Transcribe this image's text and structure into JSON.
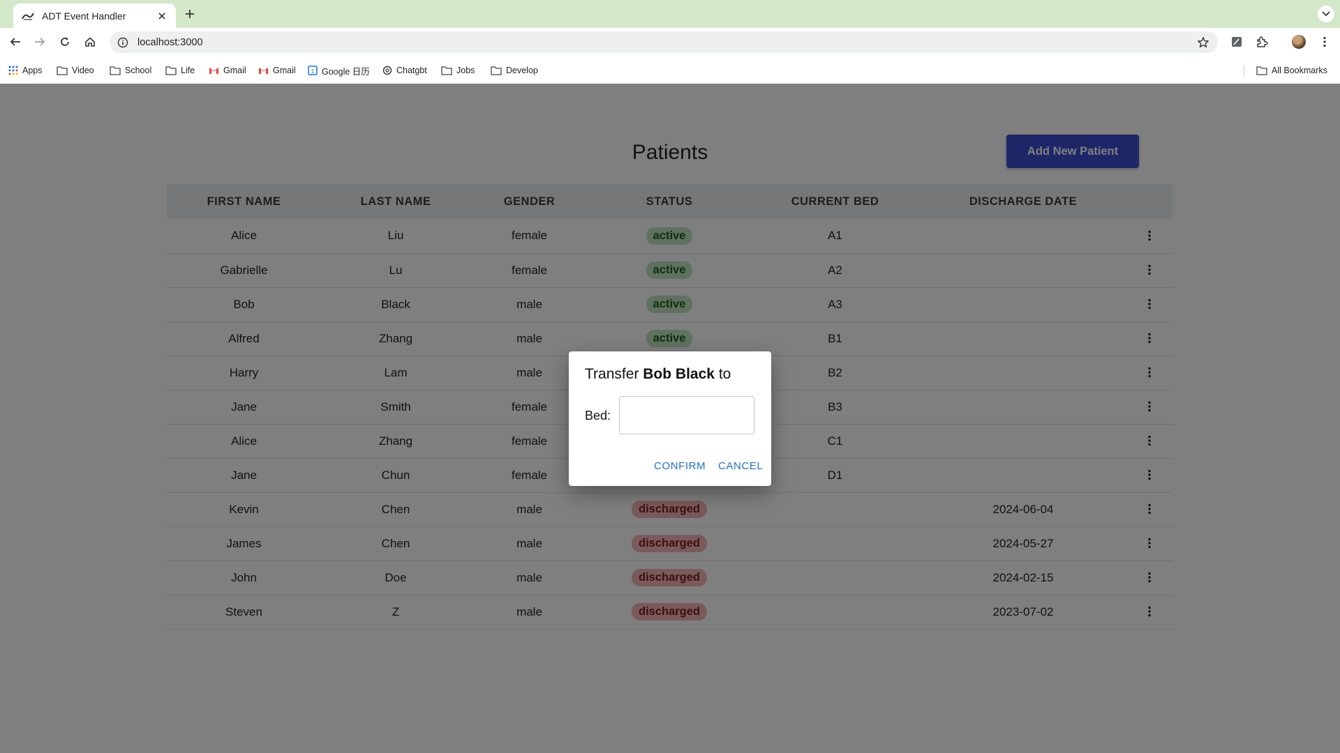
{
  "browser": {
    "tab_title": "ADT Event Handler",
    "url": "localhost:3000",
    "bookmarks": [
      {
        "label": "Apps",
        "icon": "apps-grid-icon"
      },
      {
        "label": "Video",
        "icon": "folder-icon"
      },
      {
        "label": "School",
        "icon": "folder-icon"
      },
      {
        "label": "Life",
        "icon": "folder-icon"
      },
      {
        "label": "Gmail",
        "icon": "gmail-icon"
      },
      {
        "label": "Gmail",
        "icon": "gmail-icon"
      },
      {
        "label": "Google 日历",
        "icon": "google-calendar-icon"
      },
      {
        "label": "Chatgbt",
        "icon": "chatgpt-icon"
      },
      {
        "label": "Jobs",
        "icon": "folder-icon"
      },
      {
        "label": "Develop",
        "icon": "folder-icon"
      }
    ],
    "all_bookmarks_label": "All Bookmarks"
  },
  "page": {
    "title": "Patients",
    "add_button": "Add New Patient",
    "columns": [
      "FIRST NAME",
      "LAST NAME",
      "GENDER",
      "STATUS",
      "CURRENT BED",
      "DISCHARGE DATE"
    ],
    "rows": [
      {
        "first": "Alice",
        "last": "Liu",
        "gender": "female",
        "status": "active",
        "bed": "A1",
        "discharge": ""
      },
      {
        "first": "Gabrielle",
        "last": "Lu",
        "gender": "female",
        "status": "active",
        "bed": "A2",
        "discharge": ""
      },
      {
        "first": "Bob",
        "last": "Black",
        "gender": "male",
        "status": "active",
        "bed": "A3",
        "discharge": ""
      },
      {
        "first": "Alfred",
        "last": "Zhang",
        "gender": "male",
        "status": "active",
        "bed": "B1",
        "discharge": ""
      },
      {
        "first": "Harry",
        "last": "Lam",
        "gender": "male",
        "status": "",
        "bed": "B2",
        "discharge": ""
      },
      {
        "first": "Jane",
        "last": "Smith",
        "gender": "female",
        "status": "",
        "bed": "B3",
        "discharge": ""
      },
      {
        "first": "Alice",
        "last": "Zhang",
        "gender": "female",
        "status": "",
        "bed": "C1",
        "discharge": ""
      },
      {
        "first": "Jane",
        "last": "Chun",
        "gender": "female",
        "status": "",
        "bed": "D1",
        "discharge": ""
      },
      {
        "first": "Kevin",
        "last": "Chen",
        "gender": "male",
        "status": "discharged",
        "bed": "",
        "discharge": "2024-06-04"
      },
      {
        "first": "James",
        "last": "Chen",
        "gender": "male",
        "status": "discharged",
        "bed": "",
        "discharge": "2024-05-27"
      },
      {
        "first": "John",
        "last": "Doe",
        "gender": "male",
        "status": "discharged",
        "bed": "",
        "discharge": "2024-02-15"
      },
      {
        "first": "Steven",
        "last": "Z",
        "gender": "male",
        "status": "discharged",
        "bed": "",
        "discharge": "2023-07-02"
      }
    ]
  },
  "dialog": {
    "title_prefix": "Transfer",
    "patient_name": "Bob Black",
    "title_suffix": "to",
    "bed_label": "Bed:",
    "bed_value": "",
    "confirm": "CONFIRM",
    "cancel": "CANCEL"
  },
  "colors": {
    "tabstrip": "#d3e8c8",
    "add_button": "#3a4fd0",
    "active_badge": "#bfe3bf",
    "discharged_badge": "#f5b4b4",
    "dialog_action": "#1f6fd0"
  }
}
